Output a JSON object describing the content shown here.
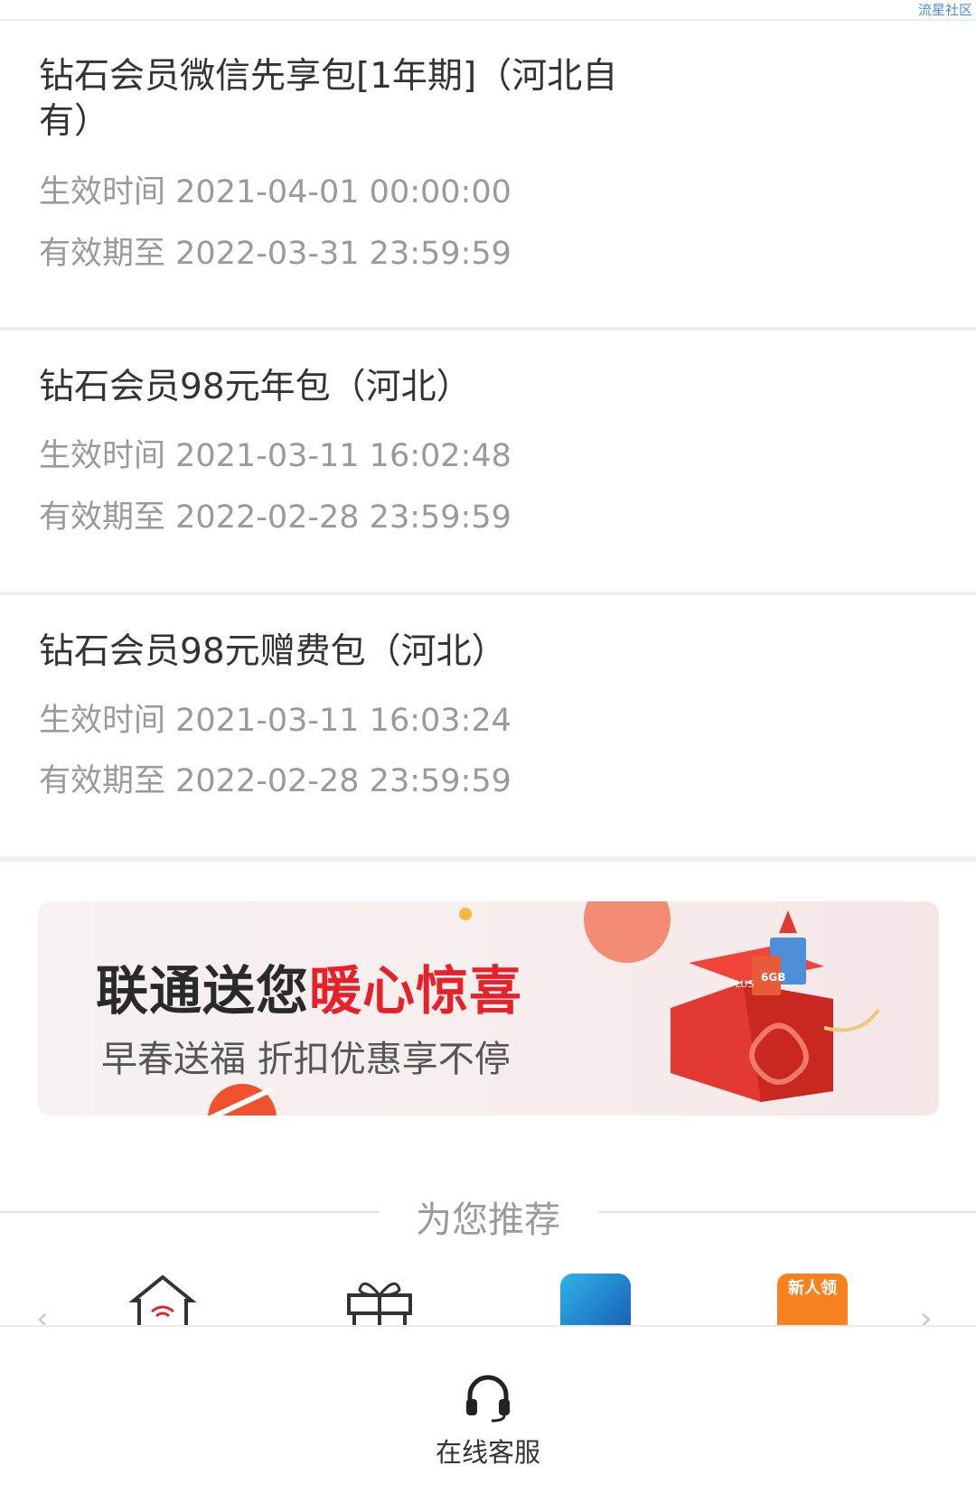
{
  "watermark": "流星社区",
  "packages": [
    {
      "title": "钻石会员微信先享包[1年期]（河北自有）",
      "start_label": "生效时间",
      "start_value": "2021-04-01 00:00:00",
      "end_label": "有效期至",
      "end_value": "2022-03-31 23:59:59"
    },
    {
      "title": "钻石会员98元年包（河北）",
      "start_label": "生效时间",
      "start_value": "2021-03-11 16:02:48",
      "end_label": "有效期至",
      "end_value": "2022-02-28 23:59:59"
    },
    {
      "title": "钻石会员98元赠费包（河北）",
      "start_label": "生效时间",
      "start_value": "2021-03-11 16:03:24",
      "end_label": "有效期至",
      "end_value": "2022-02-28 23:59:59"
    }
  ],
  "banner": {
    "title_part1": "联通送您",
    "title_highlight": "暖心惊喜",
    "subtitle": "早春送福 折扣优惠享不停",
    "box_tag_1": "6GB",
    "box_tag_2": "PLUS",
    "accent_color": "#e8202a"
  },
  "recommend": {
    "title": "为您推荐",
    "items": [
      {
        "icon": "home-wifi-icon"
      },
      {
        "icon": "gift-icon"
      },
      {
        "icon": "game-app-icon"
      },
      {
        "icon": "new-user-icon",
        "badge": "新人领"
      }
    ]
  },
  "bottom": {
    "service_label": "在线客服",
    "service_icon": "headset-icon"
  }
}
